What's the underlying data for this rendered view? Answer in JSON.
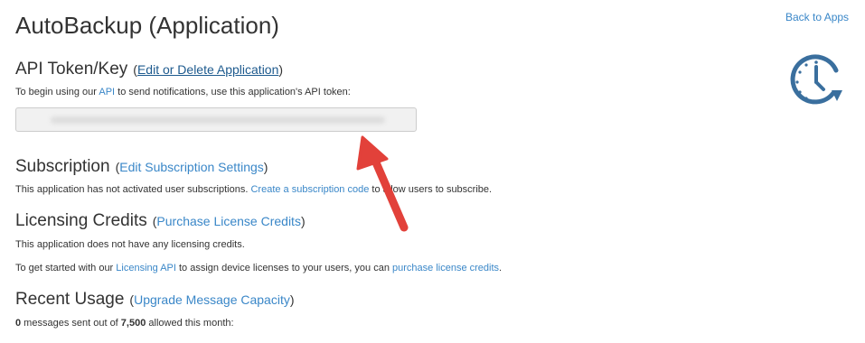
{
  "page": {
    "title": "AutoBackup (Application)",
    "back_link": "Back to Apps"
  },
  "api_token": {
    "heading": "API Token/Key",
    "paren_open": "(",
    "edit_link": "Edit or Delete Application",
    "paren_close": ")",
    "intro_before": "To begin using our ",
    "intro_link": "API",
    "intro_after": " to send notifications, use this application's API token:",
    "token_value": ""
  },
  "subscription": {
    "heading": "Subscription",
    "paren_open": "(",
    "edit_link": "Edit Subscription Settings",
    "paren_close": ")",
    "text_before": "This application has not activated user subscriptions. ",
    "create_link": "Create a subscription code",
    "text_after": " to allow users to subscribe."
  },
  "licensing": {
    "heading": "Licensing Credits",
    "paren_open": "(",
    "purchase_link": "Purchase License Credits",
    "paren_close": ")",
    "no_credits_text": "This application does not have any licensing credits.",
    "getting_started_before": "To get started with our ",
    "licensing_api_link": "Licensing API",
    "getting_started_middle": " to assign device licenses to your users, you can ",
    "purchase_credits_link": "purchase license credits",
    "getting_started_after": "."
  },
  "usage": {
    "heading": "Recent Usage",
    "paren_open": "(",
    "upgrade_link": "Upgrade Message Capacity",
    "paren_close": ")",
    "sent_count": "0",
    "text_middle": " messages sent out of ",
    "allowed_count": "7,500",
    "text_after": " allowed this month:"
  },
  "colors": {
    "link": "#3a87c8",
    "icon": "#3a6f9e",
    "arrow": "#e2413a"
  }
}
